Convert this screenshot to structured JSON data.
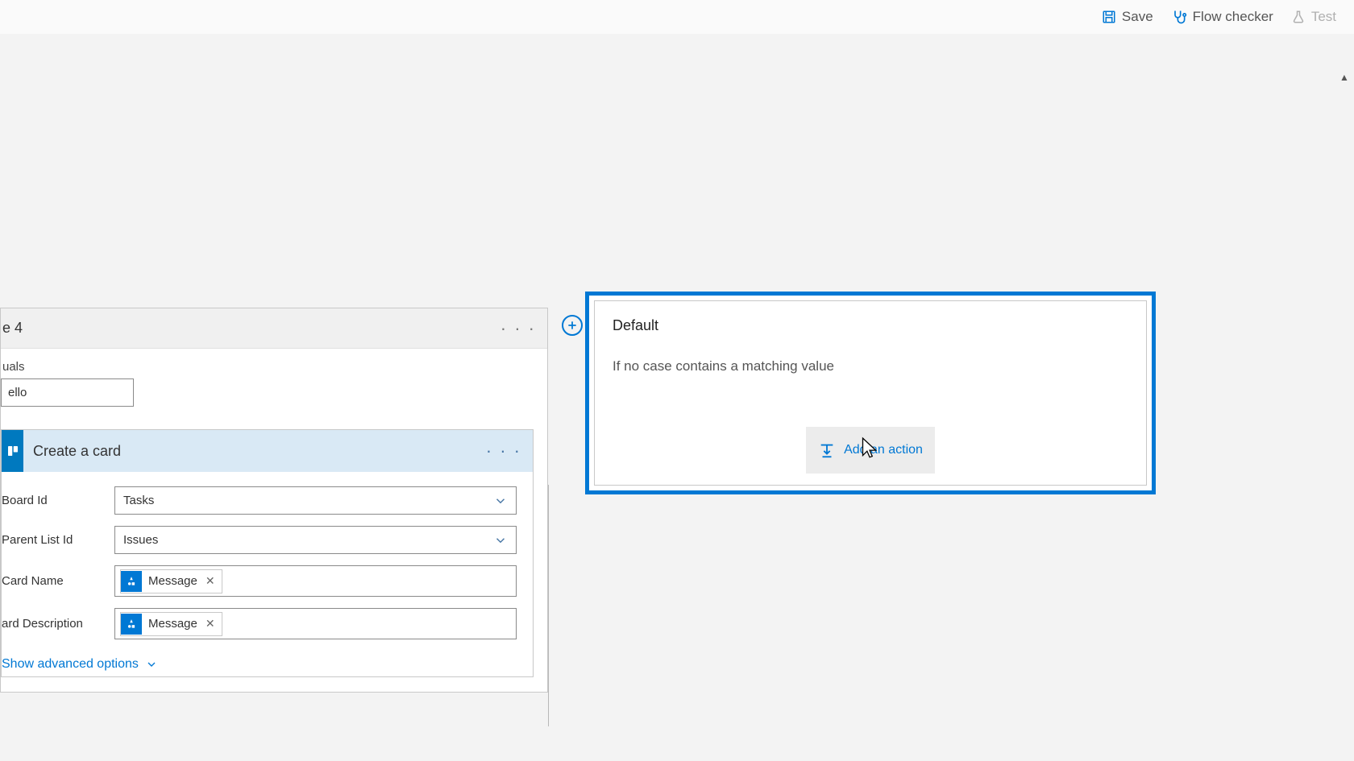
{
  "toolbar": {
    "save": "Save",
    "flow_checker": "Flow checker",
    "test": "Test"
  },
  "case": {
    "title_fragment": "e 4",
    "equals_label_fragment": "uals",
    "equals_value": "ello"
  },
  "action": {
    "title": "Create a card",
    "fields": {
      "board_id": {
        "label": "Board Id",
        "value": "Tasks"
      },
      "parent_list_id": {
        "label": "Parent List Id",
        "value": "Issues"
      },
      "card_name": {
        "label": "Card Name",
        "token": "Message"
      },
      "card_description": {
        "label": "ard Description",
        "token": "Message"
      }
    },
    "advanced": "Show advanced options"
  },
  "default_branch": {
    "title": "Default",
    "description": "If no case contains a matching value",
    "add_action": "Add an action"
  }
}
